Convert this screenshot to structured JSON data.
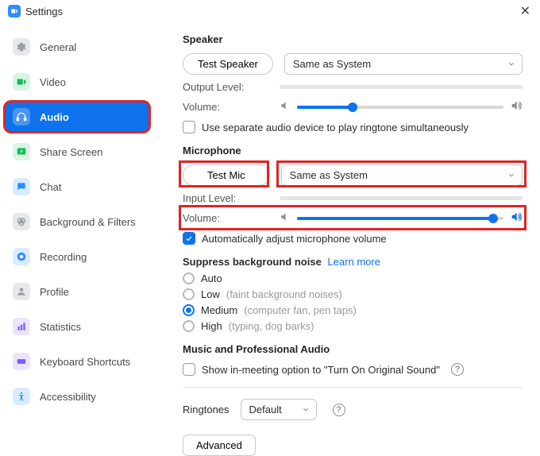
{
  "window": {
    "title": "Settings"
  },
  "sidebar": {
    "items": [
      {
        "label": "General"
      },
      {
        "label": "Video"
      },
      {
        "label": "Audio"
      },
      {
        "label": "Share Screen"
      },
      {
        "label": "Chat"
      },
      {
        "label": "Background & Filters"
      },
      {
        "label": "Recording"
      },
      {
        "label": "Profile"
      },
      {
        "label": "Statistics"
      },
      {
        "label": "Keyboard Shortcuts"
      },
      {
        "label": "Accessibility"
      }
    ]
  },
  "speaker": {
    "heading": "Speaker",
    "test_button": "Test Speaker",
    "device": "Same as System",
    "output_level_label": "Output Level:",
    "volume_label": "Volume:",
    "volume_percent": 27,
    "separate_device_label": "Use separate audio device to play ringtone simultaneously"
  },
  "microphone": {
    "heading": "Microphone",
    "test_button": "Test Mic",
    "device": "Same as System",
    "input_level_label": "Input Level:",
    "volume_label": "Volume:",
    "volume_percent": 95,
    "auto_adjust_label": "Automatically adjust microphone volume"
  },
  "suppress": {
    "heading": "Suppress background noise",
    "learn_more": "Learn more",
    "options": {
      "auto": "Auto",
      "low": "Low",
      "low_hint": "(faint background noises)",
      "medium": "Medium",
      "medium_hint": "(computer fan, pen taps)",
      "high": "High",
      "high_hint": "(typing, dog barks)"
    }
  },
  "music_pro": {
    "heading": "Music and Professional Audio",
    "original_sound_label": "Show in-meeting option to \"Turn On Original Sound\""
  },
  "ringtones": {
    "label": "Ringtones",
    "value": "Default"
  },
  "advanced": {
    "button_label": "Advanced"
  }
}
